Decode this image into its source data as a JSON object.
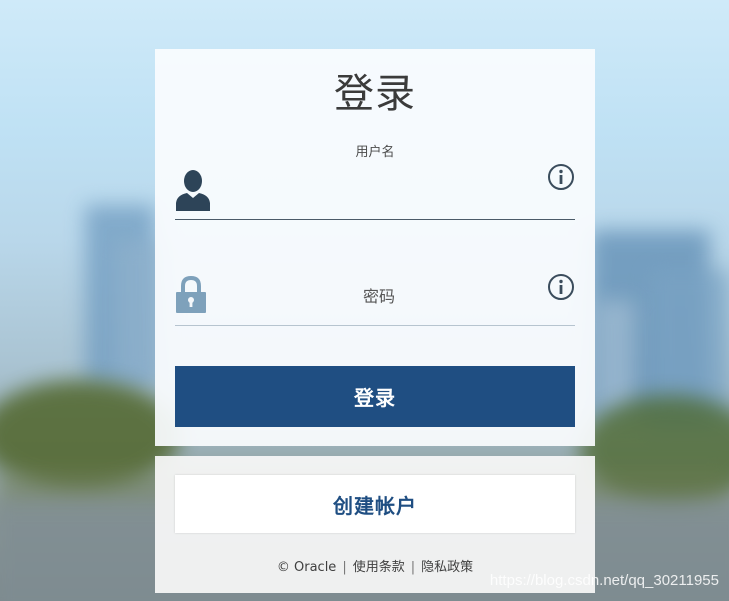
{
  "login_panel": {
    "title": "登录",
    "username": {
      "label": "用户名",
      "value": "",
      "icon": "user-icon",
      "info_icon": "info-icon"
    },
    "password": {
      "placeholder": "密码",
      "value": "",
      "icon": "lock-icon",
      "info_icon": "info-icon"
    },
    "submit_label": "登录"
  },
  "account_panel": {
    "create_label": "创建帐户",
    "footer": {
      "copyright": "© Oracle",
      "terms": "使用条款",
      "privacy": "隐私政策",
      "separator": "|"
    }
  },
  "watermark": "https://blog.csdn.net/qq_30211955",
  "colors": {
    "primary": "#1f4e82",
    "icon": "#2d4458",
    "lock": "#7ea1bb"
  }
}
